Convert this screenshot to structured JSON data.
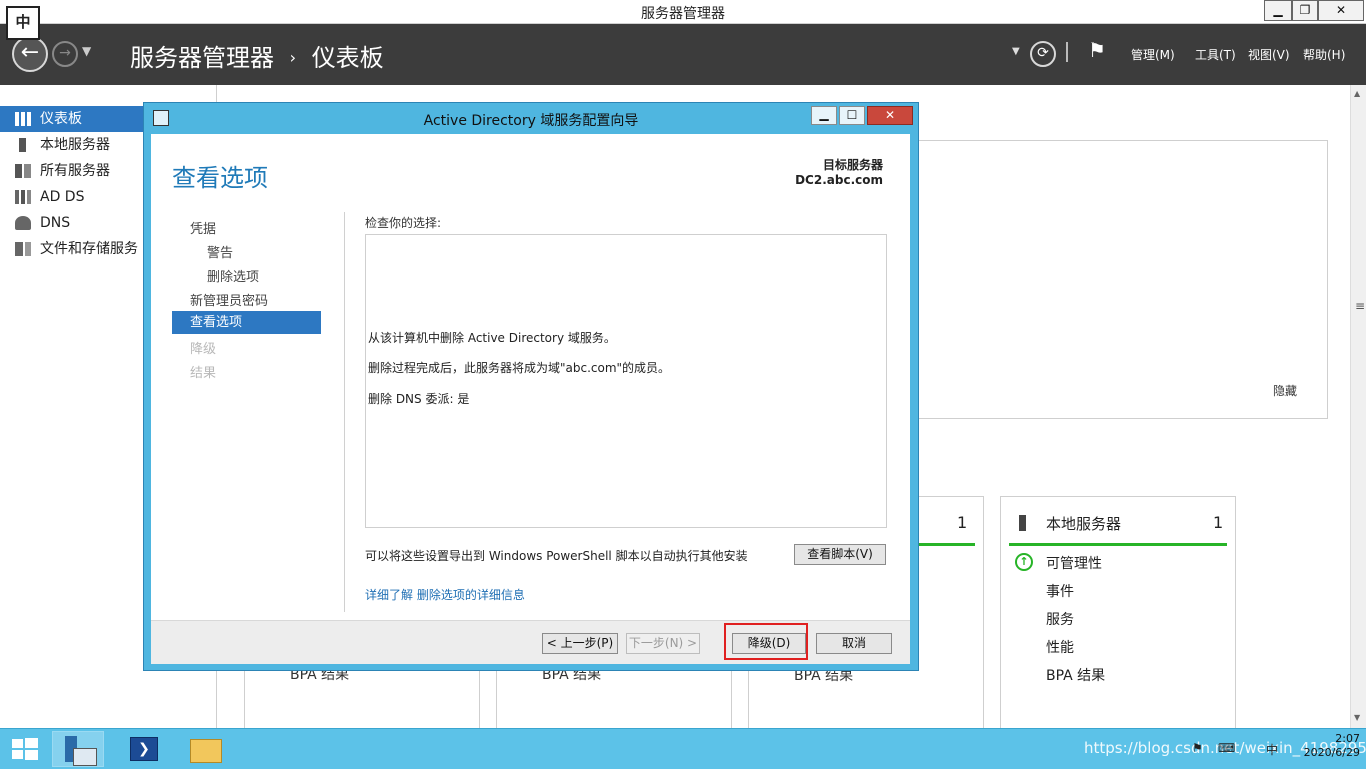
{
  "window": {
    "title": "服务器管理器",
    "minimize": "▁",
    "restore": "❐",
    "close": "✕"
  },
  "ime": {
    "label": "中"
  },
  "header": {
    "breadcrumb_root": "服务器管理器",
    "breadcrumb_sep": "›",
    "breadcrumb_current": "仪表板",
    "menus": [
      "管理(M)",
      "工具(T)",
      "视图(V)",
      "帮助(H)"
    ]
  },
  "sidebar": {
    "items": [
      {
        "label": "仪表板",
        "icon": "dashboard-icon"
      },
      {
        "label": "本地服务器",
        "icon": "server-icon"
      },
      {
        "label": "所有服务器",
        "icon": "servers-icon"
      },
      {
        "label": "AD DS",
        "icon": "adds-icon"
      },
      {
        "label": "DNS",
        "icon": "dns-icon"
      },
      {
        "label": "文件和存储服务",
        "icon": "storage-icon"
      }
    ]
  },
  "main": {
    "hide_label": "隐藏",
    "tile_count_left": "1",
    "local_tile": {
      "title": "本地服务器",
      "count": "1",
      "rows": [
        "可管理性",
        "事件",
        "服务",
        "性能",
        "BPA 结果"
      ]
    },
    "bpa_labels": [
      "BPA 结果",
      "BPA 结果",
      "BPA 结果"
    ]
  },
  "dialog": {
    "title": "Active Directory 域服务配置向导",
    "heading": "查看选项",
    "target_label": "目标服务器",
    "target_value": "DC2.abc.com",
    "steps": [
      {
        "label": "凭据",
        "state": "normal"
      },
      {
        "label": "警告",
        "state": "normal"
      },
      {
        "label": "删除选项",
        "state": "normal"
      },
      {
        "label": "新管理员密码",
        "state": "normal"
      },
      {
        "label": "查看选项",
        "state": "selected"
      },
      {
        "label": "降级",
        "state": "disabled"
      },
      {
        "label": "结果",
        "state": "disabled"
      }
    ],
    "review_label": "检查你的选择:",
    "review_lines": [
      "从该计算机中删除 Active Directory 域服务。",
      "删除过程完成后，此服务器将成为域\"abc.com\"的成员。",
      "删除 DNS 委派: 是"
    ],
    "export_text": "可以将这些设置导出到 Windows PowerShell 脚本以自动执行其他安装",
    "view_script": "查看脚本(V)",
    "learn_more": "详细了解 删除选项的详细信息",
    "buttons": {
      "prev": "< 上一步(P)",
      "next": "下一步(N) >",
      "demote": "降级(D)",
      "cancel": "取消"
    }
  },
  "taskbar": {
    "time": "2:07",
    "date": "2020/6/29",
    "watermark": "https://blog.csdn.net/weixin_41982957",
    "tray_ime": "中"
  }
}
